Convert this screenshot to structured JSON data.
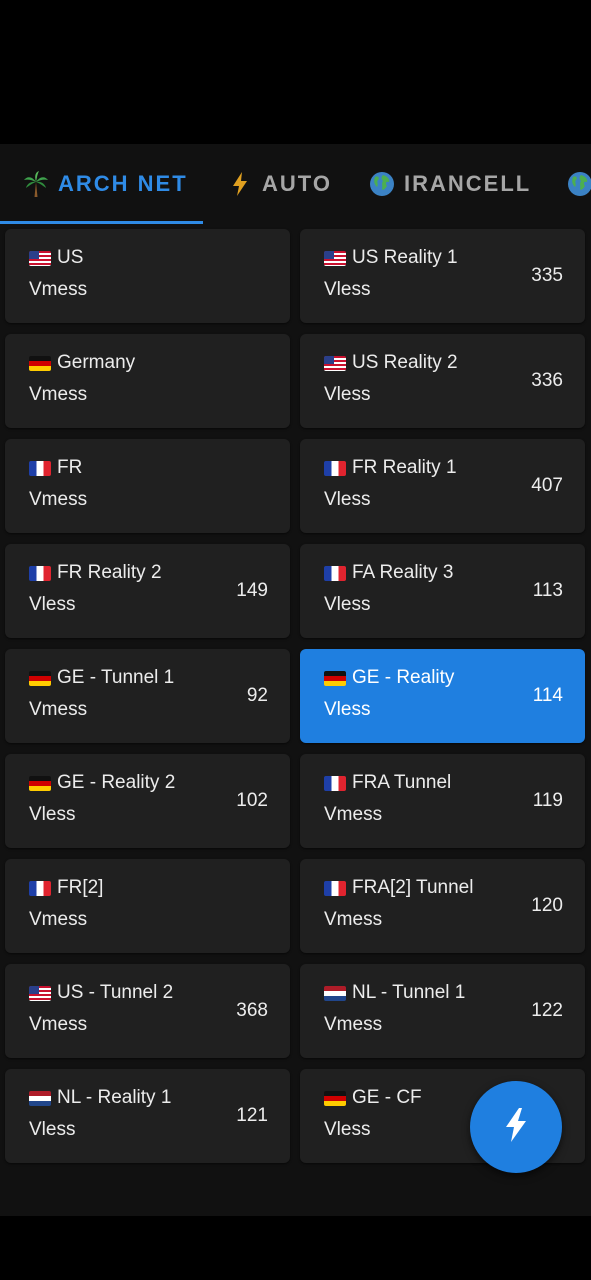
{
  "status_bar": {},
  "tabs": [
    {
      "label": "ARCH NET",
      "icon": "palm-tree-icon",
      "active": true
    },
    {
      "label": "AUTO",
      "icon": "lightning-icon",
      "active": false
    },
    {
      "label": "IRANCELL",
      "icon": "globe-icon",
      "active": false
    },
    {
      "label": "",
      "icon": "globe-icon",
      "active": false
    }
  ],
  "servers": [
    {
      "flag": "us",
      "name": "US",
      "protocol": "Vmess",
      "ping": ""
    },
    {
      "flag": "us",
      "name": "US Reality 1",
      "protocol": "Vless",
      "ping": "335"
    },
    {
      "flag": "de",
      "name": "Germany",
      "protocol": "Vmess",
      "ping": ""
    },
    {
      "flag": "us",
      "name": "US Reality 2",
      "protocol": "Vless",
      "ping": "336"
    },
    {
      "flag": "fr",
      "name": "FR",
      "protocol": "Vmess",
      "ping": ""
    },
    {
      "flag": "fr",
      "name": "FR Reality 1",
      "protocol": "Vless",
      "ping": "407"
    },
    {
      "flag": "fr",
      "name": "FR Reality 2",
      "protocol": "Vless",
      "ping": "149"
    },
    {
      "flag": "fr",
      "name": "FA Reality 3",
      "protocol": "Vless",
      "ping": "113"
    },
    {
      "flag": "de",
      "name": "GE - Tunnel 1",
      "protocol": "Vmess",
      "ping": "92"
    },
    {
      "flag": "de",
      "name": "GE - Reality",
      "protocol": "Vless",
      "ping": "114",
      "selected": true
    },
    {
      "flag": "de",
      "name": "GE - Reality 2",
      "protocol": "Vless",
      "ping": "102"
    },
    {
      "flag": "fr",
      "name": "FRA Tunnel",
      "protocol": "Vmess",
      "ping": "119"
    },
    {
      "flag": "fr",
      "name": "FR[2]",
      "protocol": "Vmess",
      "ping": ""
    },
    {
      "flag": "fr",
      "name": "FRA[2] Tunnel",
      "protocol": "Vmess",
      "ping": "120"
    },
    {
      "flag": "us",
      "name": "US - Tunnel 2",
      "protocol": "Vmess",
      "ping": "368"
    },
    {
      "flag": "nl",
      "name": "NL - Tunnel 1",
      "protocol": "Vmess",
      "ping": "122"
    },
    {
      "flag": "nl",
      "name": "NL - Reality 1",
      "protocol": "Vless",
      "ping": "121"
    },
    {
      "flag": "de",
      "name": "GE - CF",
      "protocol": "Vless",
      "ping": ""
    }
  ],
  "fab": {
    "icon": "lightning-icon"
  },
  "colors": {
    "accent": "#1f7fe0",
    "tab_active": "#2f8be6",
    "card_bg": "#202020",
    "app_bg": "#111111"
  }
}
